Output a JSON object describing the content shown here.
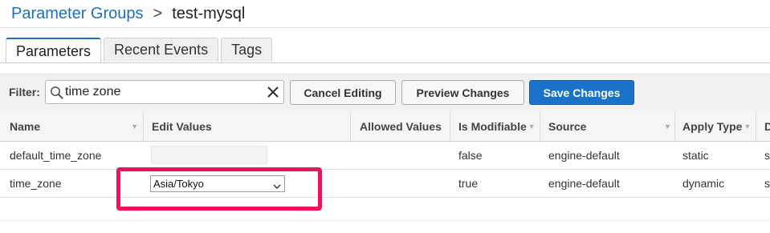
{
  "breadcrumb": {
    "parent": "Parameter Groups",
    "separator": ">",
    "current": "test-mysql"
  },
  "tabs": [
    {
      "label": "Parameters",
      "active": true
    },
    {
      "label": "Recent Events",
      "active": false
    },
    {
      "label": "Tags",
      "active": false
    }
  ],
  "filter": {
    "label": "Filter:",
    "value": "time zone",
    "search_icon": "search-icon",
    "clear_icon": "close-icon"
  },
  "buttons": {
    "cancel": "Cancel Editing",
    "preview": "Preview Changes",
    "save": "Save Changes"
  },
  "columns": {
    "name": "Name",
    "edit_values": "Edit Values",
    "allowed_values": "Allowed Values",
    "is_modifiable": "Is Modifiable",
    "source": "Source",
    "apply_type": "Apply Type",
    "description_partial": "D"
  },
  "rows": [
    {
      "name": "default_time_zone",
      "edit_value": "",
      "allowed_values": "",
      "is_modifiable": "false",
      "source": "engine-default",
      "apply_type": "static",
      "description_partial": "st"
    },
    {
      "name": "time_zone",
      "edit_value": "Asia/Tokyo",
      "allowed_values": "",
      "is_modifiable": "true",
      "source": "engine-default",
      "apply_type": "dynamic",
      "description_partial": "st"
    }
  ],
  "colors": {
    "link": "#1f70b8",
    "primary_button": "#1a73c8",
    "highlight": "#f0115e"
  }
}
